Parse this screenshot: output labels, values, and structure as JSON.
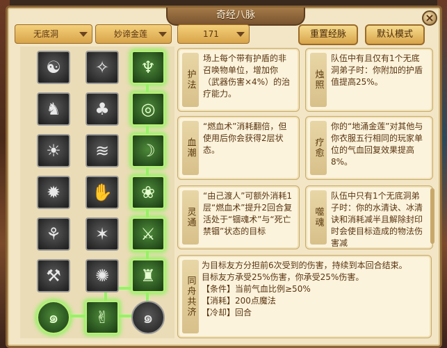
{
  "window": {
    "title": "奇经八脉",
    "close_label": "×"
  },
  "filters": {
    "school": "无底洞",
    "path": "妙谛金莲",
    "level": "171"
  },
  "buttons": {
    "reset": "重置经脉",
    "default": "默认模式"
  },
  "skills": [
    {
      "name": "护法",
      "desc": "场上每个带有护盾的非召唤物单位，增加你（武器伤害×4%）的治疗能力。"
    },
    {
      "name": "烛照",
      "desc": "队伍中有且仅有1个无底洞弟子时：你附加的护盾值提高25%。"
    },
    {
      "name": "血潮",
      "desc": "“燃血术”消耗翻倍，但使用后你会获得2层状态。"
    },
    {
      "name": "疗愈",
      "desc": "你的“地涌金莲”对其他与你衣服五行相同的玩家单位的气血回复效果提高8%。"
    },
    {
      "name": "灵通",
      "desc": "“由己渡人”可额外消耗1层“燃血术”提升2回合复活处于“锢魂术”与“死亡禁锢”状态的目标"
    },
    {
      "name": "噬魂",
      "desc": "队伍中只有1个无底洞弟子时：你的水清诀、冰清诀和消耗减半且解除封印时会使目标造成的物法伤害减"
    }
  ],
  "selected": {
    "name": "同舟共济",
    "lines": [
      "为目标友方分担前6次受到的伤害，持续到本回合结束。",
      "目标友方承受25%伤害，你承受25%伤害。",
      "【条件】当前气血比例≥50%",
      "【消耗】200点魔法",
      "【冷却】回合"
    ]
  },
  "nodes": [
    {
      "icon": "meditate-icon",
      "glyph": "☯"
    },
    {
      "icon": "wind-blade-icon",
      "glyph": "✧"
    },
    {
      "icon": "lotus-pagoda-icon",
      "glyph": "♆"
    },
    {
      "icon": "dragon-icon",
      "glyph": "♞"
    },
    {
      "icon": "tree-stump-icon",
      "glyph": "♣"
    },
    {
      "icon": "ring-spirit-icon",
      "glyph": "◎"
    },
    {
      "icon": "sun-icon",
      "glyph": "☀"
    },
    {
      "icon": "tornado-icon",
      "glyph": "≋"
    },
    {
      "icon": "blood-tide-icon",
      "glyph": "☽"
    },
    {
      "icon": "bomb-icon",
      "glyph": "✹"
    },
    {
      "icon": "claw-icon",
      "glyph": "✋"
    },
    {
      "icon": "lotus-flower-icon",
      "glyph": "❀"
    },
    {
      "icon": "boot-icon",
      "glyph": "⚘"
    },
    {
      "icon": "spiked-hand-icon",
      "glyph": "✶"
    },
    {
      "icon": "warriors-icon",
      "glyph": "⚔"
    },
    {
      "icon": "axe-icon",
      "glyph": "⚒"
    },
    {
      "icon": "whirl-icon",
      "glyph": "✺"
    },
    {
      "icon": "pagoda-icon",
      "glyph": "♜"
    },
    {
      "icon": "spiral-orb-left-icon",
      "glyph": "๑"
    },
    {
      "icon": "hands-icon",
      "glyph": "✌"
    },
    {
      "icon": "spiral-orb-right-icon",
      "glyph": "๑"
    }
  ]
}
